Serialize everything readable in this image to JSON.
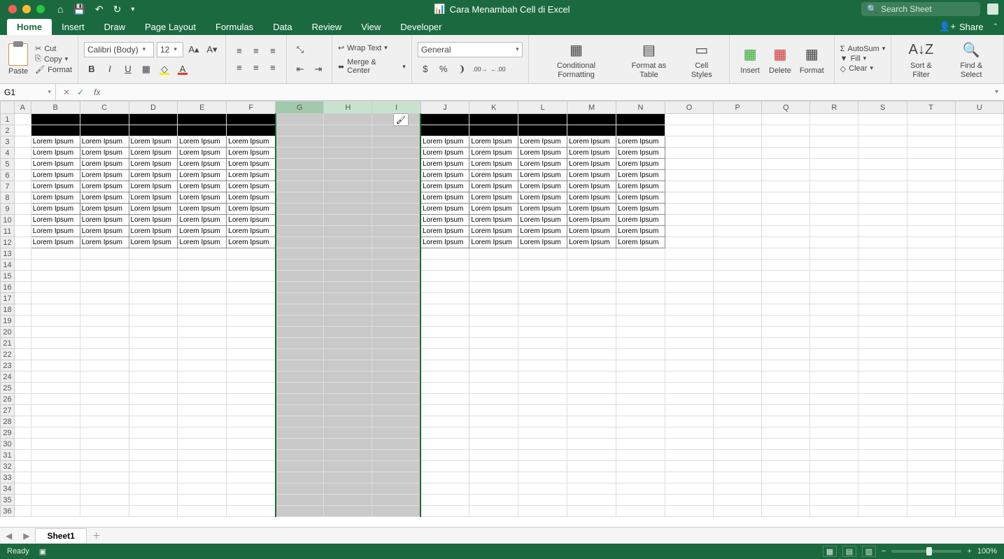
{
  "title": "Cara Menambah Cell di Excel",
  "search_placeholder": "Search Sheet",
  "tabs": [
    "Home",
    "Insert",
    "Draw",
    "Page Layout",
    "Formulas",
    "Data",
    "Review",
    "View",
    "Developer"
  ],
  "share": "Share",
  "ribbon": {
    "paste": "Paste",
    "cut": "Cut",
    "copy": "Copy",
    "format_p": "Format",
    "font_name": "Calibri (Body)",
    "font_size": "12",
    "wrap": "Wrap Text",
    "merge": "Merge & Center",
    "num_format": "General",
    "cond": "Conditional Formatting",
    "as_table": "Format as Table",
    "cell_styles": "Cell Styles",
    "insert": "Insert",
    "delete": "Delete",
    "format": "Format",
    "autosum": "AutoSum",
    "fill": "Fill",
    "clear": "Clear",
    "sort": "Sort & Filter",
    "find": "Find & Select"
  },
  "namebox": "G1",
  "columns": [
    "A",
    "B",
    "C",
    "D",
    "E",
    "F",
    "G",
    "H",
    "I",
    "J",
    "K",
    "L",
    "M",
    "N",
    "O",
    "P",
    "Q",
    "R",
    "S",
    "T",
    "U"
  ],
  "selected_cols": [
    "G",
    "H",
    "I"
  ],
  "row_count": 36,
  "data_cell": "Lorem Ipsum",
  "data_cols": [
    "B",
    "C",
    "D",
    "E",
    "F",
    "J",
    "K",
    "L",
    "M",
    "N"
  ],
  "black_cols_all": [
    "B",
    "C",
    "D",
    "E",
    "F",
    "G",
    "H",
    "I",
    "J",
    "K",
    "L",
    "M",
    "N"
  ],
  "data_row_start": 3,
  "data_row_end": 12,
  "sheet": "Sheet1",
  "status": "Ready",
  "zoom": "100%"
}
